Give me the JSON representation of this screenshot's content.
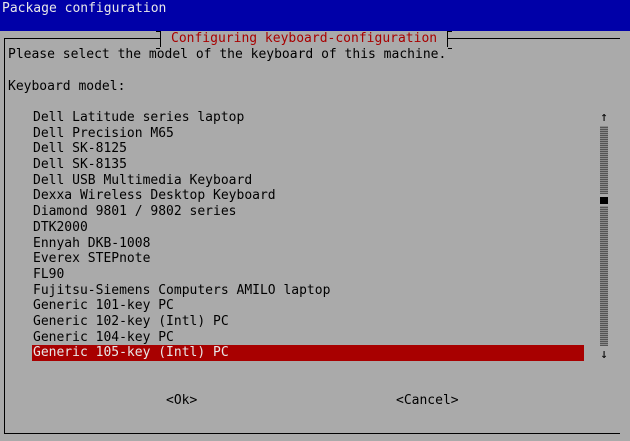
{
  "screen": {
    "title": "Package configuration"
  },
  "dialog": {
    "title": "Configuring keyboard-configuration",
    "prompt": "Please select the model of the keyboard of this machine.",
    "field_label": "Keyboard model:",
    "items": [
      {
        "label": "Dell Latitude series laptop",
        "selected": false
      },
      {
        "label": "Dell Precision M65",
        "selected": false
      },
      {
        "label": "Dell SK-8125",
        "selected": false
      },
      {
        "label": "Dell SK-8135",
        "selected": false
      },
      {
        "label": "Dell USB Multimedia Keyboard",
        "selected": false
      },
      {
        "label": "Dexxa Wireless Desktop Keyboard",
        "selected": false
      },
      {
        "label": "Diamond 9801 / 9802 series",
        "selected": false
      },
      {
        "label": "DTK2000",
        "selected": false
      },
      {
        "label": "Ennyah DKB-1008",
        "selected": false
      },
      {
        "label": "Everex STEPnote",
        "selected": false
      },
      {
        "label": "FL90",
        "selected": false
      },
      {
        "label": "Fujitsu-Siemens Computers AMILO laptop",
        "selected": false
      },
      {
        "label": "Generic 101-key PC",
        "selected": false
      },
      {
        "label": "Generic 102-key (Intl) PC",
        "selected": false
      },
      {
        "label": "Generic 104-key PC",
        "selected": false
      },
      {
        "label": "Generic 105-key (Intl) PC",
        "selected": true
      }
    ],
    "scrollbar": {
      "up_glyph": "↑",
      "down_glyph": "↓",
      "position_fraction": 0.33
    },
    "buttons": {
      "ok": "<Ok>",
      "cancel": "<Cancel>"
    }
  },
  "colors": {
    "screen_background": "#0000a8",
    "dialog_background": "#aaaaaa",
    "title_text": "#a80000",
    "selection_background": "#a80000",
    "selection_text": "#e8e8e8"
  }
}
